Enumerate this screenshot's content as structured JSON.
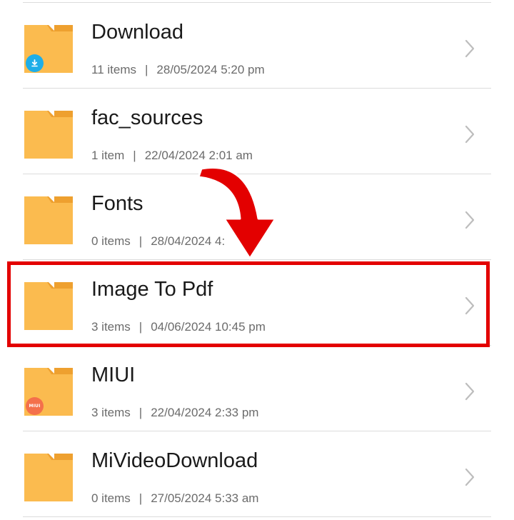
{
  "folders": [
    {
      "name": "Download",
      "count": "11 items",
      "date": "28/05/2024 5:20 pm",
      "badge": "download-icon"
    },
    {
      "name": "fac_sources",
      "count": "1 item",
      "date": "22/04/2024 2:01 am",
      "badge": ""
    },
    {
      "name": "Fonts",
      "count": "0 items",
      "date": "28/04/2024 4:",
      "badge": ""
    },
    {
      "name": "Image To Pdf",
      "count": "3 items",
      "date": "04/06/2024 10:45 pm",
      "badge": ""
    },
    {
      "name": "MIUI",
      "count": "3 items",
      "date": "22/04/2024 2:33 pm",
      "badge": "miui-icon",
      "badge_text": "MIUI"
    },
    {
      "name": "MiVideoDownload",
      "count": "0 items",
      "date": "27/05/2024 5:33 am",
      "badge": ""
    }
  ],
  "colors": {
    "folder_body": "#fbbb4f",
    "folder_tab": "#eea02f",
    "highlight": "#e30000",
    "download_badge": "#1eaee8",
    "miui_badge": "#f4704b"
  },
  "annotation": {
    "highlighted_folder": "Image To Pdf",
    "arrow": "curved-down-arrow-icon"
  }
}
